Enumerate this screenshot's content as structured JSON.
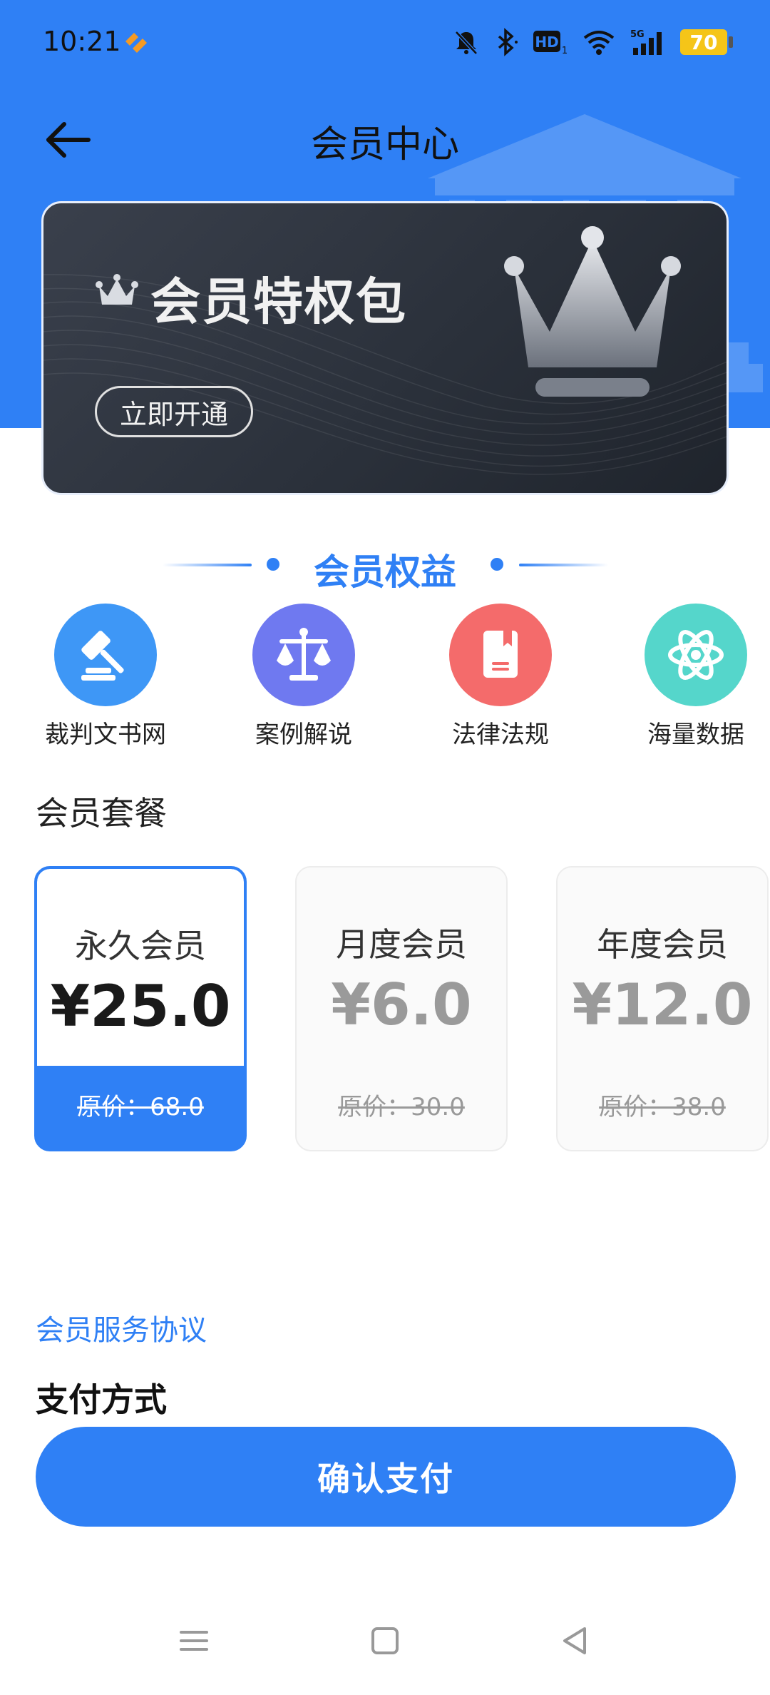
{
  "status_bar": {
    "time": "10:21",
    "battery": "70",
    "network": "5G",
    "hd_label": "HD",
    "hd_sub": "1"
  },
  "header": {
    "title": "会员中心"
  },
  "vip_card": {
    "title": "会员特权包",
    "button_label": "立即开通"
  },
  "benefits": {
    "heading": "会员权益",
    "items": [
      {
        "label": "裁判文书网",
        "icon": "gavel-icon",
        "color": "#3e97f6"
      },
      {
        "label": "案例解说",
        "icon": "scales-icon",
        "color": "#6f79f0"
      },
      {
        "label": "法律法规",
        "icon": "book-icon",
        "color": "#f46b6b"
      },
      {
        "label": "海量数据",
        "icon": "atom-icon",
        "color": "#55d6cb"
      }
    ]
  },
  "plans": {
    "title": "会员套餐",
    "items": [
      {
        "name": "永久会员",
        "price": "¥25.0",
        "original": "原价：68.0",
        "selected": true
      },
      {
        "name": "月度会员",
        "price": "¥6.0",
        "original": "原价：30.0",
        "selected": false
      },
      {
        "name": "年度会员",
        "price": "¥12.0",
        "original": "原价：38.0",
        "selected": false
      }
    ]
  },
  "agreement_link": "会员服务协议",
  "payment": {
    "title": "支付方式",
    "confirm_label": "确认支付"
  },
  "colors": {
    "primary": "#2f80f5",
    "card_dark": "#2b313b"
  }
}
